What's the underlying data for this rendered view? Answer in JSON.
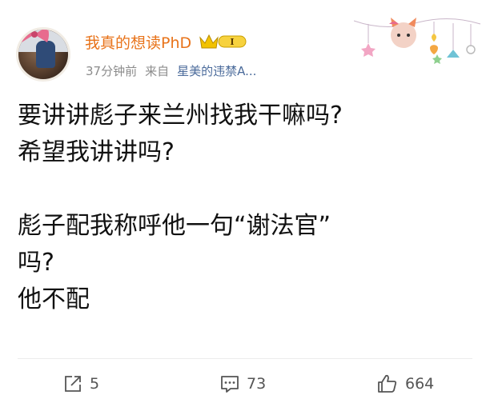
{
  "post": {
    "username": "我真的想读PhD",
    "vip_level": "I",
    "time": "37分钟前",
    "source_prefix": "来自",
    "source": "星美的违禁A...",
    "content_lines": [
      "要讲讲彪子来兰州找我干嘛吗?",
      "希望我讲讲吗?",
      "",
      "彪子配我称呼他一句“谢法官”",
      "吗?",
      "他不配"
    ]
  },
  "actions": {
    "repost_count": "5",
    "comment_count": "73",
    "like_count": "664"
  },
  "colors": {
    "username": "#e8731a",
    "meta": "#8c8c8c",
    "link": "#4b6b9b",
    "vip_gold": "#f2c200"
  },
  "icons": [
    "repost-icon",
    "comment-icon",
    "like-icon",
    "vip-crown-icon",
    "decoration-icon"
  ]
}
